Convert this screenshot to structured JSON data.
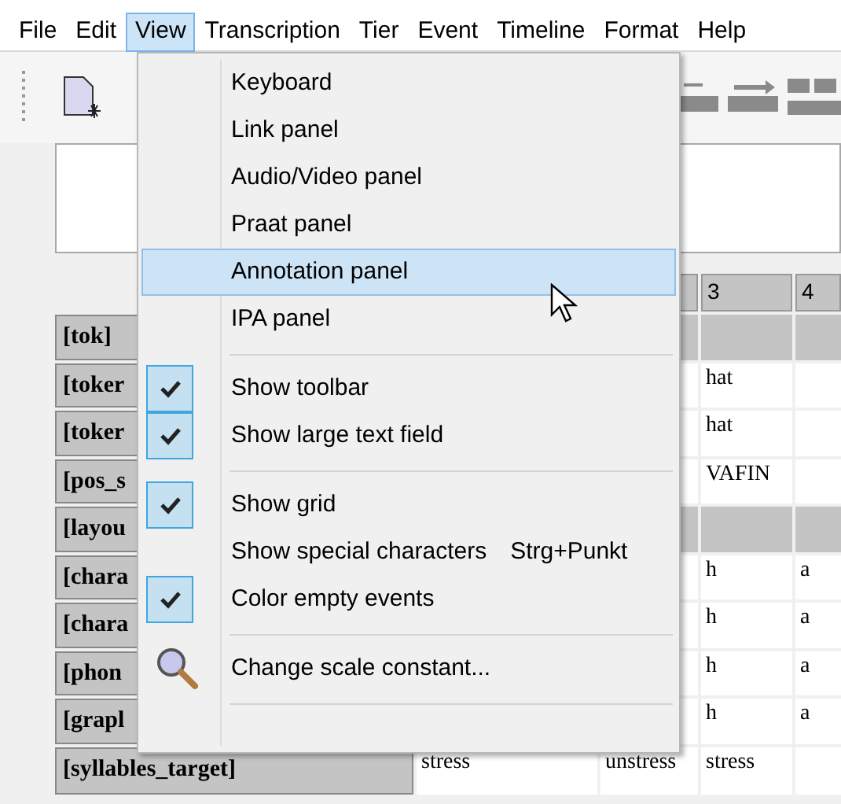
{
  "menubar": [
    {
      "label": "File",
      "selected": false
    },
    {
      "label": "Edit",
      "selected": false
    },
    {
      "label": "View",
      "selected": true
    },
    {
      "label": "Transcription",
      "selected": false
    },
    {
      "label": "Tier",
      "selected": false
    },
    {
      "label": "Event",
      "selected": false
    },
    {
      "label": "Timeline",
      "selected": false
    },
    {
      "label": "Format",
      "selected": false
    },
    {
      "label": "Help",
      "selected": false
    }
  ],
  "table": {
    "column_headers": [
      "3",
      "4"
    ],
    "rows": [
      {
        "label": "[tok]",
        "shaded": true,
        "cells": []
      },
      {
        "label": "[toker",
        "shaded": false,
        "cells": [
          "hat"
        ]
      },
      {
        "label": "[toker",
        "shaded": false,
        "cells": [
          "hat"
        ]
      },
      {
        "label": "[pos_s",
        "shaded": false,
        "cells": [
          "VAFIN"
        ]
      },
      {
        "label": "[layou",
        "shaded": true,
        "cells": []
      },
      {
        "label": "[chara",
        "shaded": false,
        "cells": [
          "h",
          "a"
        ]
      },
      {
        "label": "[chara",
        "shaded": false,
        "cells": [
          "h",
          "a"
        ]
      },
      {
        "label": "[phon",
        "shaded": false,
        "cells": [
          "h",
          "a"
        ]
      },
      {
        "label": "[grapl",
        "shaded": false,
        "cells": [
          "h",
          "a"
        ]
      }
    ],
    "last_row": {
      "label": "[syllables_target]",
      "cells": [
        {
          "text": "stress",
          "wide": true
        },
        {
          "text": "unstress",
          "wide": false
        },
        {
          "text": "stress",
          "wide": false
        }
      ]
    }
  },
  "view_menu": [
    {
      "kind": "item",
      "label": "Keyboard",
      "checked": false,
      "selected": false
    },
    {
      "kind": "item",
      "label": "Link panel",
      "checked": false,
      "selected": false
    },
    {
      "kind": "item",
      "label": "Audio/Video panel",
      "checked": false,
      "selected": false
    },
    {
      "kind": "item",
      "label": "Praat panel",
      "checked": false,
      "selected": false
    },
    {
      "kind": "item",
      "label": "Annotation panel",
      "checked": false,
      "selected": true
    },
    {
      "kind": "item",
      "label": "IPA panel",
      "checked": false,
      "selected": false
    },
    {
      "kind": "separator"
    },
    {
      "kind": "item",
      "label": "Show toolbar",
      "checked": true,
      "selected": false
    },
    {
      "kind": "item",
      "label": "Show large text field",
      "checked": true,
      "selected": false
    },
    {
      "kind": "separator"
    },
    {
      "kind": "item",
      "label": "Show grid",
      "checked": true,
      "selected": false
    },
    {
      "kind": "item",
      "label": "Show special characters",
      "shortcut": "Strg+Punkt",
      "checked": false,
      "selected": false
    },
    {
      "kind": "item",
      "label": "Color empty events",
      "checked": true,
      "selected": false
    },
    {
      "kind": "separator"
    },
    {
      "kind": "icon_item",
      "label": "Change scale constant...",
      "checked": false,
      "selected": false
    },
    {
      "kind": "separator"
    }
  ]
}
